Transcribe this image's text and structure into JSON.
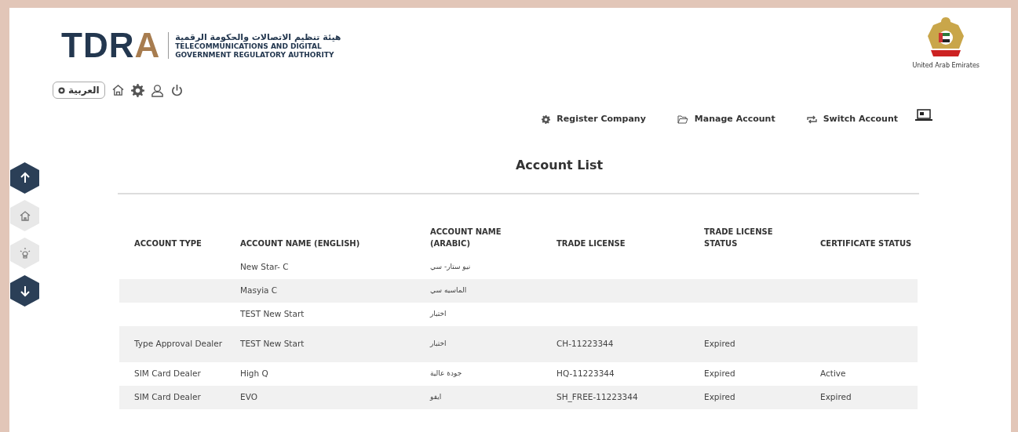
{
  "header": {
    "logo": {
      "mark": "TDRA",
      "arabic": "هيئة تنظيم الاتصالات والحكومة الرقمية",
      "english_1": "TELECOMMUNICATIONS AND DIGITAL",
      "english_2": "GOVERNMENT REGULATORY AUTHORITY"
    },
    "emblem_caption": "United Arab Emirates"
  },
  "toolbar": {
    "language": "العربية"
  },
  "nav_links": [
    {
      "label": "Register Company",
      "kind": "register"
    },
    {
      "label": "Manage Account",
      "kind": "manage"
    },
    {
      "label": "Switch Account",
      "kind": "switch"
    }
  ],
  "page_title": "Account List",
  "table": {
    "columns": [
      "ACCOUNT TYPE",
      "ACCOUNT NAME (ENGLISH)",
      "ACCOUNT NAME (ARABIC)",
      "TRADE LICENSE",
      "TRADE LICENSE STATUS",
      "CERTIFICATE STATUS"
    ],
    "rows": [
      [
        "",
        "New Star- C",
        "نيو ستار- سي",
        "",
        "",
        ""
      ],
      [
        "",
        "Masyia C",
        "الماسيه سي",
        "",
        "",
        ""
      ],
      [
        "",
        "TEST New Start",
        "اختبار",
        "",
        "",
        ""
      ],
      [
        "Type Approval Dealer",
        "TEST New Start",
        "اختبار",
        "CH-11223344",
        "Expired",
        ""
      ],
      [
        "SIM Card Dealer",
        "High Q",
        "جودة عالية",
        "HQ-11223344",
        "Expired",
        "Active"
      ],
      [
        "SIM Card Dealer",
        "EVO",
        "ايفو",
        "SH_FREE-11223344",
        "Expired",
        "Expired"
      ]
    ]
  },
  "side_buttons": [
    {
      "kind": "up"
    },
    {
      "kind": "home"
    },
    {
      "kind": "idea"
    },
    {
      "kind": "down"
    }
  ]
}
